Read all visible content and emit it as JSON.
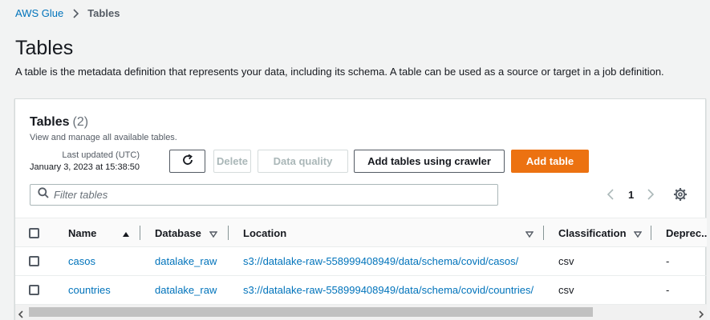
{
  "breadcrumb": {
    "root": "AWS Glue",
    "current": "Tables"
  },
  "page": {
    "title": "Tables",
    "description": "A table is the metadata definition that represents your data, including its schema. A table can be used as a source or target in a job definition."
  },
  "panel": {
    "title": "Tables",
    "count": "(2)",
    "subtitle": "View and manage all available tables.",
    "last_updated_label": "Last updated (UTC)",
    "last_updated_value": "January 3, 2023 at 15:38:50"
  },
  "toolbar": {
    "refresh_icon": "refresh-icon",
    "delete_label": "Delete",
    "data_quality_label": "Data quality",
    "crawler_label": "Add tables using crawler",
    "add_table_label": "Add table",
    "accent_color": "#ec7211"
  },
  "filter": {
    "placeholder": "Filter tables",
    "value": ""
  },
  "pagination": {
    "current_page": "1"
  },
  "table": {
    "columns": {
      "name": "Name",
      "database": "Database",
      "location": "Location",
      "classification": "Classification",
      "deprecated": "Deprec..."
    },
    "sorted_by": "Name",
    "sort_direction": "ascending",
    "rows": [
      {
        "name": "casos",
        "database": "datalake_raw",
        "location": "s3://datalake-raw-558999408949/data/schema/covid/casos/",
        "classification": "csv",
        "deprecated": "-"
      },
      {
        "name": "countries",
        "database": "datalake_raw",
        "location": "s3://datalake-raw-558999408949/data/schema/covid/countries/",
        "classification": "csv",
        "deprecated": "-"
      }
    ]
  },
  "colors": {
    "link": "#0073bb",
    "primary_button": "#ec7211",
    "background": "#f2f3f3"
  }
}
